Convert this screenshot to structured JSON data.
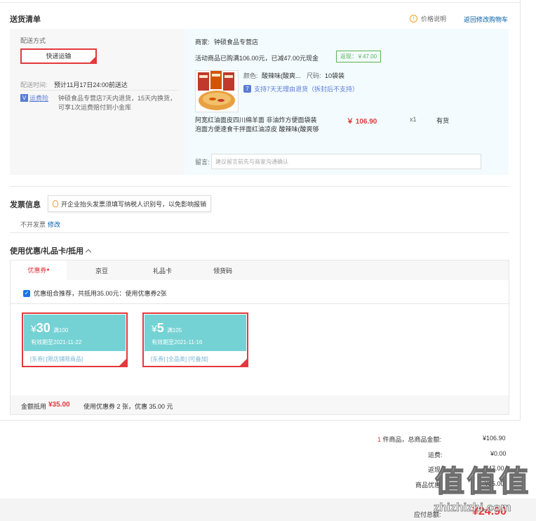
{
  "delivery": {
    "section_title": "送货清单",
    "price_info_label": "价格说明",
    "back_to_cart": "返回修改购物车",
    "method_label": "配送方式",
    "method_value": "快递运输",
    "time_label": "配送时间:",
    "time_value": "预计11月17日24:00前送达",
    "insurance_tag": "运费险",
    "insurance_text_1": "钟硕食品专营店7天内退货，15天内换货，",
    "insurance_text_2": "可享1次运费赔付到小金库"
  },
  "shop": {
    "seller_label": "商家:",
    "seller_name": "钟硕食品专营店",
    "promo_text": "活动商品已购满106.00元，已减47.00元现金",
    "rebate_tag": "返现：￥47.00",
    "color_label": "颜色:",
    "color_value": "酸辣味(酸爽...",
    "size_label": "尺码:",
    "size_value": "10袋装",
    "return_policy": "支持7天无理由退货（拆封后不支持）",
    "product_name_1": "阿宽红油面皮四川绵羊面 非油炸方便面袋装",
    "product_name_2": "泡面方便速食干拌面红油凉皮 酸辣味(酸爽够",
    "price": "￥ 106.90",
    "qty": "x1",
    "stock": "有货",
    "note_label": "留言:",
    "note_placeholder": "建议留言前先与商家沟通确认"
  },
  "invoice": {
    "title": "发票信息",
    "tip": "开企业抬头发票须填写纳税人识别号，以免影响报销",
    "status": "不开发票",
    "edit_link": "修改"
  },
  "coupon": {
    "title": "使用优惠/礼品卡/抵用",
    "tabs": [
      "优惠券",
      "京豆",
      "礼品卡",
      "领货码"
    ],
    "recommend_text": "优惠组合推荐，共抵用35.00元：使用优惠券2张",
    "cards": [
      {
        "symbol": "¥",
        "amount": "30",
        "cond": "满100",
        "expiry": "有效期至2021-11-22",
        "tags": "[东券]  [限店铺限商品]"
      },
      {
        "symbol": "¥",
        "amount": "5",
        "cond": "满105",
        "expiry": "有效期至2021-11-16",
        "tags": "[东券]  [全品类]  [可叠加]"
      }
    ],
    "sum_label": "金额抵用",
    "sum_value": "¥35.00",
    "sum_detail": "使用优惠券 2 张，优惠 35.00 元"
  },
  "totals": {
    "count_num": "1",
    "count_label": "件商品，总商品金额:",
    "goods_total": "¥106.90",
    "shipping_label": "运费:",
    "shipping_value": "¥0.00",
    "rebate_label": "返现:",
    "rebate_value": "-¥47.00",
    "discount_label": "商品优惠:",
    "discount_value": "-¥35.00",
    "payable_label": "应付总额:",
    "payable_value": "¥24.90"
  },
  "watermark": "值 值 值",
  "watermark_url": "zhizhizhi.com",
  "colors": {
    "accent": "#e4393c",
    "coupon_bg": "#74d2d4",
    "shop_bg": "#f3fbfe",
    "panel_bg": "#f7f7f7"
  }
}
